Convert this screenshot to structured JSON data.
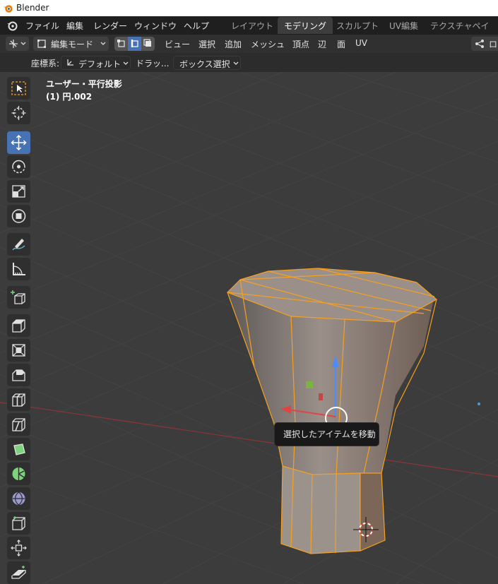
{
  "window": {
    "title": "Blender"
  },
  "menu": [
    "ファイル",
    "編集",
    "レンダー",
    "ウィンドウ",
    "ヘルプ"
  ],
  "workspaces": [
    {
      "label": "レイアウト",
      "active": false
    },
    {
      "label": "モデリング",
      "active": true
    },
    {
      "label": "スカルプト",
      "active": false
    },
    {
      "label": "UV編集",
      "active": false
    },
    {
      "label": "テクスチャペイント",
      "active": false
    }
  ],
  "header": {
    "mode": "編集モード",
    "view_menu": [
      "ビュー",
      "選択",
      "追加",
      "メッシュ",
      "頂点",
      "辺",
      "面",
      "UV"
    ],
    "right_cut": "ロ"
  },
  "tool_settings": {
    "orientation_label": "座標系:",
    "orientation_value": "デフォルト",
    "drag_label": "ドラッ...",
    "drag_value": "ボックス選択"
  },
  "viewport": {
    "view_name": "ユーザー・平行投影",
    "object_name": "(1) 円.002"
  },
  "tooltip": "選択したアイテムを移動",
  "tools": [
    {
      "name": "select-box-tool",
      "active": false
    },
    {
      "name": "cursor-tool",
      "active": false
    },
    {
      "name": "move-tool",
      "active": true
    },
    {
      "name": "rotate-tool",
      "active": false
    },
    {
      "name": "scale-tool",
      "active": false
    },
    {
      "name": "transform-tool",
      "active": false
    },
    {
      "name": "annotate-tool",
      "active": false
    },
    {
      "name": "measure-tool",
      "active": false
    },
    {
      "name": "add-cube-tool",
      "active": false
    },
    {
      "name": "extrude-tool",
      "active": false
    },
    {
      "name": "inset-faces-tool",
      "active": false
    },
    {
      "name": "bevel-tool",
      "active": false
    },
    {
      "name": "loop-cut-tool",
      "active": false
    },
    {
      "name": "knife-tool",
      "active": false
    },
    {
      "name": "poly-build-tool",
      "active": false
    },
    {
      "name": "spin-tool",
      "active": false
    },
    {
      "name": "smooth-tool",
      "active": false
    },
    {
      "name": "edge-slide-tool",
      "active": false
    },
    {
      "name": "shrink-fatten-tool",
      "active": false
    },
    {
      "name": "shear-tool",
      "active": false
    }
  ],
  "colors": {
    "accent": "#4772b3",
    "selection": "#f5a020",
    "x_axis": "#9b3a3a",
    "background": "#3a3a3a"
  }
}
